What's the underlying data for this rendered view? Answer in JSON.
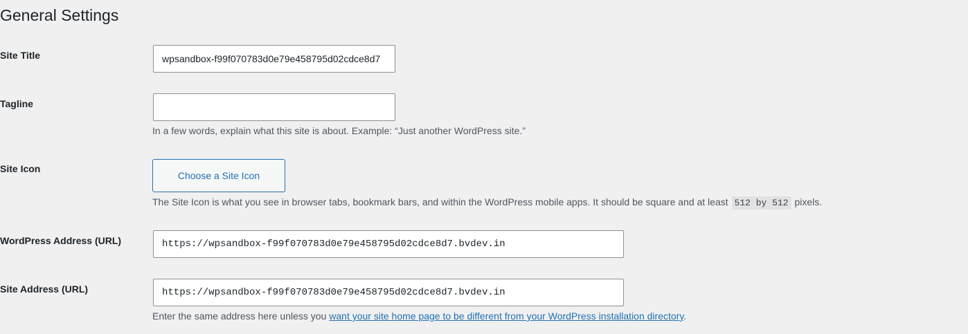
{
  "page": {
    "title": "General Settings"
  },
  "site_title": {
    "label": "Site Title",
    "value": "wpsandbox-f99f070783d0e79e458795d02cdce8d7"
  },
  "tagline": {
    "label": "Tagline",
    "value": "",
    "description": "In a few words, explain what this site is about. Example: “Just another WordPress site.”"
  },
  "site_icon": {
    "label": "Site Icon",
    "button_label": "Choose a Site Icon",
    "description_before": "The Site Icon is what you see in browser tabs, bookmark bars, and within the WordPress mobile apps. It should be square and at least",
    "description_code": "512 by 512",
    "description_after": "pixels."
  },
  "wordpress_address": {
    "label": "WordPress Address (URL)",
    "value": "https://wpsandbox-f99f070783d0e79e458795d02cdce8d7.bvdev.in"
  },
  "site_address": {
    "label": "Site Address (URL)",
    "value": "https://wpsandbox-f99f070783d0e79e458795d02cdce8d7.bvdev.in",
    "description_before": "Enter the same address here unless you",
    "description_link": "want your site home page to be different from your WordPress installation directory",
    "description_after": "."
  },
  "colors": {
    "background": "#f0f0f1",
    "accent": "#2271b1",
    "text": "#1d2327",
    "muted_text": "#50575e",
    "input_border": "#8c8f94"
  }
}
